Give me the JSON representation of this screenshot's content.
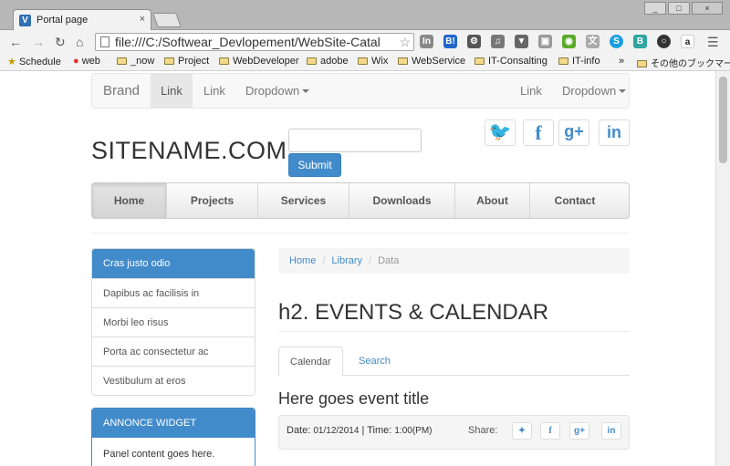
{
  "browser": {
    "tab_title": "Portal page",
    "tab_close": "×",
    "url": "file:///C:/Softwear_Devlopement/WebSite-Catal",
    "window_buttons": [
      "_",
      "□",
      "×"
    ],
    "nav_icons": [
      "back-arrow-icon",
      "forward-arrow-icon",
      "reload-icon",
      "home-icon"
    ],
    "bookmarks": [
      {
        "label": "Schedule",
        "icon": "star-icon"
      },
      {
        "label": "web",
        "icon": "chrome-icon"
      },
      {
        "label": "_now",
        "icon": "folder-icon"
      },
      {
        "label": "Project",
        "icon": "folder-icon"
      },
      {
        "label": "WebDeveloper",
        "icon": "folder-icon"
      },
      {
        "label": "adobe",
        "icon": "folder-icon"
      },
      {
        "label": "Wix",
        "icon": "folder-icon"
      },
      {
        "label": "WebService",
        "icon": "folder-icon"
      },
      {
        "label": "IT-Consalting",
        "icon": "folder-icon"
      },
      {
        "label": "IT-info",
        "icon": "folder-icon"
      }
    ],
    "bookmarks_overflow": "»",
    "other_bookmarks": "その他のブックマーク"
  },
  "navbar": {
    "brand": "Brand",
    "left_links": [
      "Link",
      "Link"
    ],
    "left_dropdown": "Dropdown",
    "right_link": "Link",
    "right_dropdown": "Dropdown"
  },
  "header": {
    "sitename": "SITENAME.COM",
    "submit_label": "Submit",
    "social": [
      {
        "name": "twitter-icon",
        "glyph": "🐦"
      },
      {
        "name": "facebook-icon",
        "glyph": "f"
      },
      {
        "name": "google-plus-icon",
        "glyph": "g+"
      },
      {
        "name": "linkedin-icon",
        "glyph": "in"
      }
    ]
  },
  "mainnav": {
    "items": [
      "Home",
      "Projects",
      "Services",
      "Downloads",
      "About",
      "Contact"
    ],
    "active": "Home"
  },
  "sidebar": {
    "items": [
      "Cras justo odio",
      "Dapibus ac facilisis in",
      "Morbi leo risus",
      "Porta ac consectetur ac",
      "Vestibulum at eros"
    ],
    "widget_title": "ANNONCE WIDGET",
    "widget_body": "Panel content goes here."
  },
  "breadcrumb": {
    "items": [
      "Home",
      "Library",
      "Data"
    ],
    "separator": "/"
  },
  "main": {
    "heading": "h2. EVENTS & CALENDAR",
    "tabs": [
      "Calendar",
      "Search"
    ],
    "event_title": "Here goes event title",
    "date_label": "Date:",
    "date_value": "01/12/2014",
    "time_label": "| Time:",
    "time_value": "1:00(PM)",
    "share_label": "Share:"
  },
  "colors": {
    "primary": "#428bca",
    "navbar_bg": "#f8f8f8",
    "text": "#333333"
  }
}
